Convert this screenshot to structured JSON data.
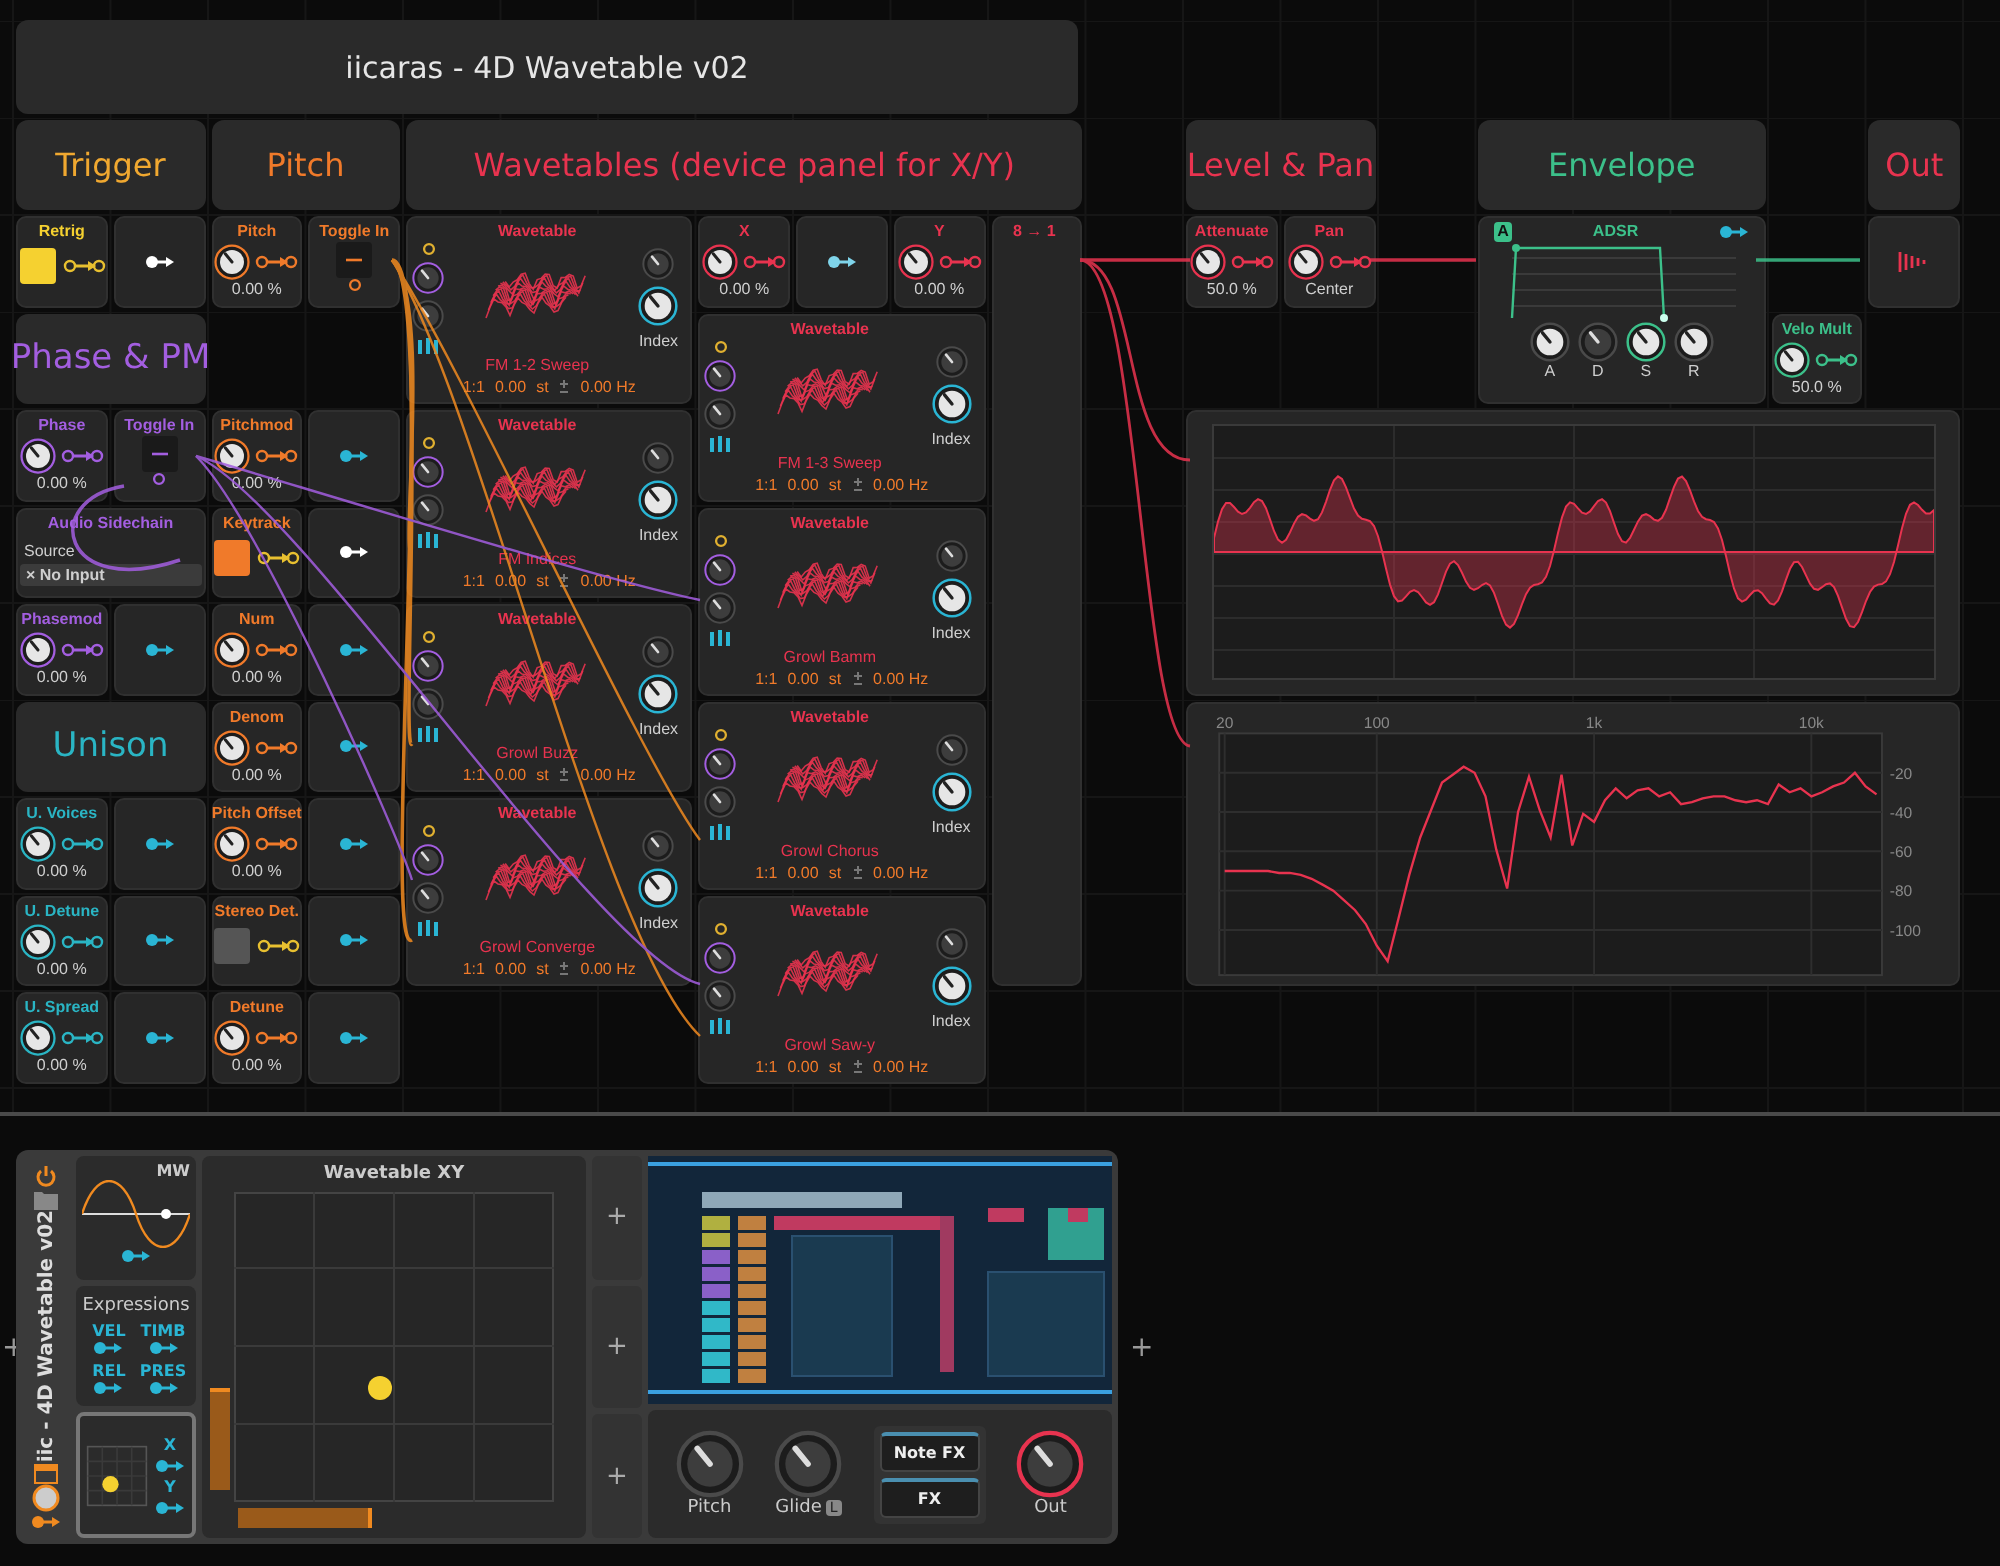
{
  "patch_title": "iicaras - 4D Wavetable v02",
  "headers": [
    {
      "label": "Trigger",
      "color": "#f0a830"
    },
    {
      "label": "Pitch",
      "color": "#f07a2a"
    },
    {
      "label": "Wavetables (device panel for X/Y)",
      "color": "#e8334f"
    },
    {
      "label": "Level & Pan",
      "color": "#e8334f"
    },
    {
      "label": "Envelope",
      "color": "#3cc08a"
    },
    {
      "label": "Out",
      "color": "#e8334f"
    }
  ],
  "modules": [
    {
      "kind": "button",
      "label": "Retrig",
      "color": "#f5d130",
      "on": true
    },
    {
      "kind": "port",
      "color": "#ffffff"
    },
    {
      "kind": "knob",
      "label": "Pitch",
      "value": "0.00 %",
      "color": "#f07a2a"
    },
    {
      "kind": "toggle",
      "label": "Toggle In",
      "color": "#f07a2a",
      "on": false
    },
    {
      "kind": "header",
      "label": "Phase & PM",
      "color": "#a35ee0"
    },
    {
      "kind": "knob",
      "label": "Phase",
      "value": "0.00 %",
      "color": "#a35ee0"
    },
    {
      "kind": "toggle",
      "label": "Toggle In",
      "color": "#a35ee0",
      "on": false
    },
    {
      "kind": "knob",
      "label": "Pitchmod",
      "value": "0.00 %",
      "color": "#f07a2a"
    },
    {
      "kind": "port",
      "color": "#2ab5d4"
    },
    {
      "kind": "sidechain",
      "label": "Audio Sidechain",
      "source_label": "Source",
      "value": "× No Input",
      "color": "#a35ee0"
    },
    {
      "kind": "button",
      "label": "Keytrack",
      "color": "#f07a2a",
      "on": true
    },
    {
      "kind": "port",
      "color": "#ffffff"
    },
    {
      "kind": "knob",
      "label": "Phasemod",
      "value": "0.00 %",
      "color": "#a35ee0"
    },
    {
      "kind": "port",
      "color": "#2ab5d4"
    },
    {
      "kind": "knob",
      "label": "Num",
      "value": "0.00 %",
      "color": "#f07a2a"
    },
    {
      "kind": "port",
      "color": "#2ab5d4"
    },
    {
      "kind": "header",
      "label": "Unison",
      "color": "#2ab5c4"
    },
    {
      "kind": "knob",
      "label": "Denom",
      "value": "0.00 %",
      "color": "#f07a2a"
    },
    {
      "kind": "port",
      "color": "#2ab5d4"
    },
    {
      "kind": "knob",
      "label": "U. Voices",
      "value": "0.00 %",
      "color": "#2ab5c4"
    },
    {
      "kind": "port",
      "color": "#2ab5d4"
    },
    {
      "kind": "knob",
      "label": "Pitch Offset",
      "value": "0.00 %",
      "color": "#f07a2a"
    },
    {
      "kind": "port",
      "color": "#2ab5d4"
    },
    {
      "kind": "knob",
      "label": "U. Detune",
      "value": "0.00 %",
      "color": "#2ab5c4"
    },
    {
      "kind": "port",
      "color": "#2ab5d4"
    },
    {
      "kind": "button",
      "label": "Stereo Det.",
      "color": "#f07a2a",
      "on": false
    },
    {
      "kind": "port",
      "color": "#2ab5d4"
    },
    {
      "kind": "knob",
      "label": "U. Spread",
      "value": "0.00 %",
      "color": "#2ab5c4"
    },
    {
      "kind": "port",
      "color": "#2ab5d4"
    },
    {
      "kind": "knob",
      "label": "Detune",
      "value": "0.00 %",
      "color": "#f07a2a"
    },
    {
      "kind": "port",
      "color": "#2ab5d4"
    },
    {
      "kind": "wavetable",
      "title": "Wavetable",
      "name": "FM 1-2 Sweep",
      "ratio": "1:1",
      "pitch": "0.00",
      "unit": "st",
      "freq": "0.00 Hz",
      "index_label": "Index"
    },
    {
      "kind": "wavetable",
      "title": "Wavetable",
      "name": "FM Indices",
      "ratio": "1:1",
      "pitch": "0.00",
      "unit": "st",
      "freq": "0.00 Hz",
      "index_label": "Index"
    },
    {
      "kind": "wavetable",
      "title": "Wavetable",
      "name": "Growl Buzz",
      "ratio": "1:1",
      "pitch": "0.00",
      "unit": "st",
      "freq": "0.00 Hz",
      "index_label": "Index"
    },
    {
      "kind": "wavetable",
      "title": "Wavetable",
      "name": "Growl Converge",
      "ratio": "1:1",
      "pitch": "0.00",
      "unit": "st",
      "freq": "0.00 Hz",
      "index_label": "Index"
    },
    {
      "kind": "knob",
      "label": "X",
      "value": "0.00 %",
      "color": "#e8334f"
    },
    {
      "kind": "port",
      "color": "#7fd4ea"
    },
    {
      "kind": "knob",
      "label": "Y",
      "value": "0.00 %",
      "color": "#e8334f"
    },
    {
      "kind": "wavetable",
      "title": "Wavetable",
      "name": "FM 1-3 Sweep",
      "ratio": "1:1",
      "pitch": "0.00",
      "unit": "st",
      "freq": "0.00 Hz",
      "index_label": "Index"
    },
    {
      "kind": "wavetable",
      "title": "Wavetable",
      "name": "Growl Bamm",
      "ratio": "1:1",
      "pitch": "0.00",
      "unit": "st",
      "freq": "0.00 Hz",
      "index_label": "Index"
    },
    {
      "kind": "wavetable",
      "title": "Wavetable",
      "name": "Growl Chorus",
      "ratio": "1:1",
      "pitch": "0.00",
      "unit": "st",
      "freq": "0.00 Hz",
      "index_label": "Index"
    },
    {
      "kind": "wavetable",
      "title": "Wavetable",
      "name": "Growl Saw-y",
      "ratio": "1:1",
      "pitch": "0.00",
      "unit": "st",
      "freq": "0.00 Hz",
      "index_label": "Index"
    },
    {
      "kind": "mixer",
      "label": "8 → 1",
      "color": "#e8334f"
    },
    {
      "kind": "knob",
      "label": "Attenuate",
      "value": "50.0 %",
      "color": "#e8334f"
    },
    {
      "kind": "knob",
      "label": "Pan",
      "value": "Center",
      "color": "#e8334f"
    },
    {
      "kind": "adsr",
      "badge": "A",
      "title": "ADSR",
      "knobs": [
        "A",
        "D",
        "S",
        "R"
      ],
      "color": "#3cc08a"
    },
    {
      "kind": "output",
      "color": "#e8334f"
    },
    {
      "kind": "knob",
      "label": "Velo Mult",
      "value": "50.0 %",
      "color": "#3cc08a"
    },
    {
      "kind": "scope",
      "color": "#e8334f"
    },
    {
      "kind": "spectrum",
      "chart_data": {
        "type": "line",
        "grid": true,
        "ylim": [
          -123,
          0
        ],
        "categories": [
          "20",
          null,
          null,
          null,
          null,
          null,
          null,
          null,
          null,
          null,
          null,
          null,
          null,
          null,
          "100",
          null,
          null,
          null,
          null,
          null,
          null,
          null,
          null,
          null,
          null,
          null,
          null,
          null,
          null,
          null,
          null,
          null,
          null,
          null,
          "1k",
          null,
          null,
          null,
          null,
          null,
          null,
          null,
          null,
          null,
          null,
          null,
          null,
          null,
          null,
          null,
          null,
          null,
          null,
          null,
          "10k",
          null,
          null,
          null,
          null,
          null,
          null
        ],
        "yticks": [
          -20,
          -40,
          -60,
          -80,
          -100
        ],
        "series": [
          {
            "color": "#e8334f",
            "values": [
              -70,
              -70,
              -70,
              -70,
              -70,
              -71,
              -71,
              -72,
              -74,
              -77,
              -80,
              -85,
              -90,
              -97,
              -108,
              -116,
              -94,
              -72,
              -53,
              -39,
              -25,
              -21,
              -17,
              -20,
              -32,
              -59,
              -79,
              -40,
              -22,
              -39,
              -53,
              -21,
              -57,
              -41,
              -45,
              -34,
              -28,
              -33,
              -29,
              -28,
              -32,
              -30,
              -36,
              -35,
              -33,
              -32,
              -32,
              -34,
              -35,
              -34,
              -36,
              -26,
              -30,
              -28,
              -32,
              -30,
              -27,
              -25,
              -20,
              -27,
              -31
            ]
          }
        ]
      }
    }
  ],
  "device": {
    "name": "iic - 4D Wavetable v02",
    "lfo": {
      "label": "MW"
    },
    "expressions": {
      "title": "Expressions",
      "items": [
        "VEL",
        "TIMB",
        "REL",
        "PRES"
      ]
    },
    "mini_xy": {
      "x_label": "X",
      "y_label": "Y"
    },
    "xy_pad": {
      "title": "Wavetable XY"
    },
    "add_slots": [
      "+",
      "+",
      "+"
    ],
    "knobs": [
      {
        "label": "Pitch"
      },
      {
        "label": "Glide",
        "badge": "L"
      }
    ],
    "fx_buttons": [
      "Note FX",
      "FX"
    ],
    "out_knob": {
      "label": "Out"
    },
    "side_add": [
      "+",
      "+"
    ]
  }
}
